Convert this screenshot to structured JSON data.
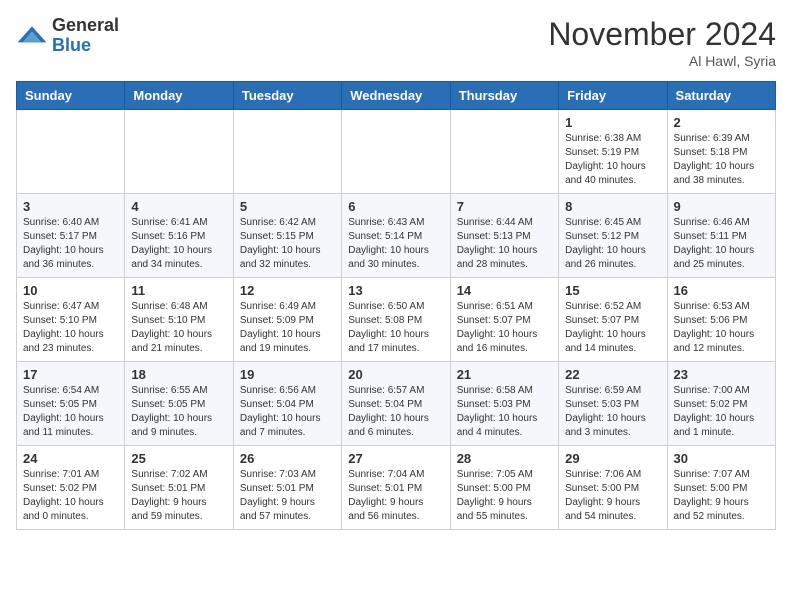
{
  "header": {
    "logo_general": "General",
    "logo_blue": "Blue",
    "month": "November 2024",
    "location": "Al Hawl, Syria"
  },
  "weekdays": [
    "Sunday",
    "Monday",
    "Tuesday",
    "Wednesday",
    "Thursday",
    "Friday",
    "Saturday"
  ],
  "weeks": [
    [
      {
        "day": "",
        "info": ""
      },
      {
        "day": "",
        "info": ""
      },
      {
        "day": "",
        "info": ""
      },
      {
        "day": "",
        "info": ""
      },
      {
        "day": "",
        "info": ""
      },
      {
        "day": "1",
        "info": "Sunrise: 6:38 AM\nSunset: 5:19 PM\nDaylight: 10 hours\nand 40 minutes."
      },
      {
        "day": "2",
        "info": "Sunrise: 6:39 AM\nSunset: 5:18 PM\nDaylight: 10 hours\nand 38 minutes."
      }
    ],
    [
      {
        "day": "3",
        "info": "Sunrise: 6:40 AM\nSunset: 5:17 PM\nDaylight: 10 hours\nand 36 minutes."
      },
      {
        "day": "4",
        "info": "Sunrise: 6:41 AM\nSunset: 5:16 PM\nDaylight: 10 hours\nand 34 minutes."
      },
      {
        "day": "5",
        "info": "Sunrise: 6:42 AM\nSunset: 5:15 PM\nDaylight: 10 hours\nand 32 minutes."
      },
      {
        "day": "6",
        "info": "Sunrise: 6:43 AM\nSunset: 5:14 PM\nDaylight: 10 hours\nand 30 minutes."
      },
      {
        "day": "7",
        "info": "Sunrise: 6:44 AM\nSunset: 5:13 PM\nDaylight: 10 hours\nand 28 minutes."
      },
      {
        "day": "8",
        "info": "Sunrise: 6:45 AM\nSunset: 5:12 PM\nDaylight: 10 hours\nand 26 minutes."
      },
      {
        "day": "9",
        "info": "Sunrise: 6:46 AM\nSunset: 5:11 PM\nDaylight: 10 hours\nand 25 minutes."
      }
    ],
    [
      {
        "day": "10",
        "info": "Sunrise: 6:47 AM\nSunset: 5:10 PM\nDaylight: 10 hours\nand 23 minutes."
      },
      {
        "day": "11",
        "info": "Sunrise: 6:48 AM\nSunset: 5:10 PM\nDaylight: 10 hours\nand 21 minutes."
      },
      {
        "day": "12",
        "info": "Sunrise: 6:49 AM\nSunset: 5:09 PM\nDaylight: 10 hours\nand 19 minutes."
      },
      {
        "day": "13",
        "info": "Sunrise: 6:50 AM\nSunset: 5:08 PM\nDaylight: 10 hours\nand 17 minutes."
      },
      {
        "day": "14",
        "info": "Sunrise: 6:51 AM\nSunset: 5:07 PM\nDaylight: 10 hours\nand 16 minutes."
      },
      {
        "day": "15",
        "info": "Sunrise: 6:52 AM\nSunset: 5:07 PM\nDaylight: 10 hours\nand 14 minutes."
      },
      {
        "day": "16",
        "info": "Sunrise: 6:53 AM\nSunset: 5:06 PM\nDaylight: 10 hours\nand 12 minutes."
      }
    ],
    [
      {
        "day": "17",
        "info": "Sunrise: 6:54 AM\nSunset: 5:05 PM\nDaylight: 10 hours\nand 11 minutes."
      },
      {
        "day": "18",
        "info": "Sunrise: 6:55 AM\nSunset: 5:05 PM\nDaylight: 10 hours\nand 9 minutes."
      },
      {
        "day": "19",
        "info": "Sunrise: 6:56 AM\nSunset: 5:04 PM\nDaylight: 10 hours\nand 7 minutes."
      },
      {
        "day": "20",
        "info": "Sunrise: 6:57 AM\nSunset: 5:04 PM\nDaylight: 10 hours\nand 6 minutes."
      },
      {
        "day": "21",
        "info": "Sunrise: 6:58 AM\nSunset: 5:03 PM\nDaylight: 10 hours\nand 4 minutes."
      },
      {
        "day": "22",
        "info": "Sunrise: 6:59 AM\nSunset: 5:03 PM\nDaylight: 10 hours\nand 3 minutes."
      },
      {
        "day": "23",
        "info": "Sunrise: 7:00 AM\nSunset: 5:02 PM\nDaylight: 10 hours\nand 1 minute."
      }
    ],
    [
      {
        "day": "24",
        "info": "Sunrise: 7:01 AM\nSunset: 5:02 PM\nDaylight: 10 hours\nand 0 minutes."
      },
      {
        "day": "25",
        "info": "Sunrise: 7:02 AM\nSunset: 5:01 PM\nDaylight: 9 hours\nand 59 minutes."
      },
      {
        "day": "26",
        "info": "Sunrise: 7:03 AM\nSunset: 5:01 PM\nDaylight: 9 hours\nand 57 minutes."
      },
      {
        "day": "27",
        "info": "Sunrise: 7:04 AM\nSunset: 5:01 PM\nDaylight: 9 hours\nand 56 minutes."
      },
      {
        "day": "28",
        "info": "Sunrise: 7:05 AM\nSunset: 5:00 PM\nDaylight: 9 hours\nand 55 minutes."
      },
      {
        "day": "29",
        "info": "Sunrise: 7:06 AM\nSunset: 5:00 PM\nDaylight: 9 hours\nand 54 minutes."
      },
      {
        "day": "30",
        "info": "Sunrise: 7:07 AM\nSunset: 5:00 PM\nDaylight: 9 hours\nand 52 minutes."
      }
    ]
  ]
}
